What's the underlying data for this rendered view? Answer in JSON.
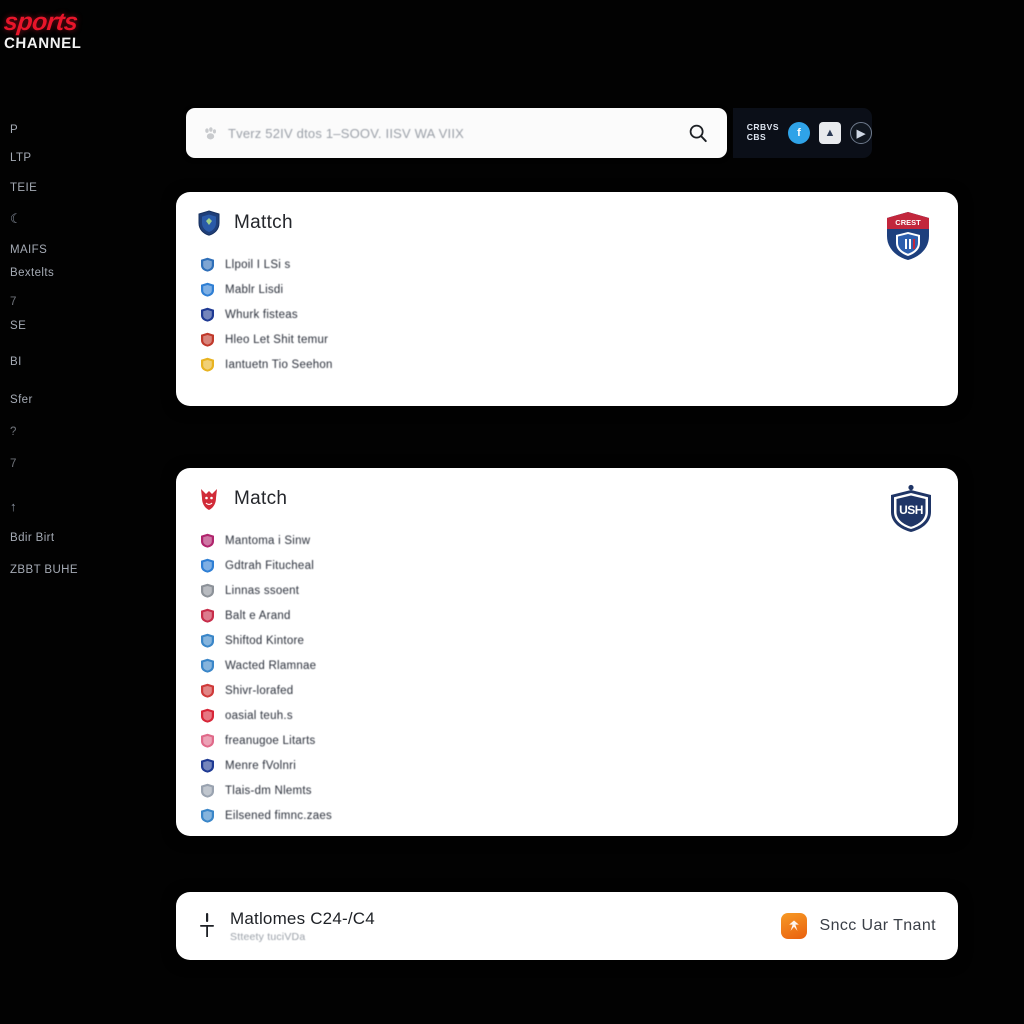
{
  "brand": {
    "line1": "sports",
    "line2": "CHANNEL",
    "accent_color": "#e8152a"
  },
  "sidebar": {
    "items": [
      {
        "label": "P",
        "kind": "text"
      },
      {
        "label": "LTP",
        "kind": "text"
      },
      {
        "label": "TEIE",
        "kind": "text"
      },
      {
        "label": "☾",
        "kind": "icon"
      },
      {
        "label": "MAIFS",
        "kind": "text"
      },
      {
        "label": "Bextelts",
        "kind": "text"
      },
      {
        "label": "7",
        "kind": "dim"
      },
      {
        "label": "SE",
        "kind": "text"
      },
      {
        "label": "BI",
        "kind": "text"
      },
      {
        "label": "Sfer",
        "kind": "text"
      },
      {
        "label": "?",
        "kind": "dim"
      },
      {
        "label": "7",
        "kind": "dim"
      },
      {
        "label": "↑",
        "kind": "icon"
      },
      {
        "label": "Bdir Birt",
        "kind": "text"
      },
      {
        "label": "ZBBT BUHE",
        "kind": "text"
      }
    ]
  },
  "search": {
    "value": "",
    "placeholder": "Tverz 52IV dtos 1–SOOV. IISV WA VIIX",
    "lead_icon": "paw-icon",
    "submit_icon": "search-icon"
  },
  "social": {
    "label": "CRBVS\nCBS",
    "icons": [
      {
        "name": "facebook-icon",
        "glyph": "f",
        "style": "blue"
      },
      {
        "name": "share-icon",
        "glyph": "▲",
        "style": "white"
      },
      {
        "name": "player-icon",
        "glyph": "▶",
        "style": "dark"
      }
    ]
  },
  "cards": [
    {
      "id": "card-1",
      "title": "Mattch",
      "crest_icon": "blue-shield-crest-icon",
      "logo_icon": "red-blue-team-crest-logo",
      "items": [
        {
          "text": "Llpoil I LSi s",
          "icon": "blue-shield-icon",
          "color": "#2f6fb8"
        },
        {
          "text": "Mablr Lisdi",
          "icon": "blue-square-icon",
          "color": "#2f7fd4"
        },
        {
          "text": "Whurk fisteas",
          "icon": "navy-crest-icon",
          "color": "#1f3a93"
        },
        {
          "text": "Hleo Let Shit temur",
          "icon": "red-crest-icon",
          "color": "#c0392b"
        },
        {
          "text": "Iantuetn Tio Seehon",
          "icon": "yellow-badge-icon",
          "color": "#e8b321"
        }
      ]
    },
    {
      "id": "card-2",
      "title": "Match",
      "crest_icon": "red-bull-crest-icon",
      "logo_icon": "navy-usa-shield-logo",
      "items": [
        {
          "text": "Mantoma i  Sinw",
          "icon": "magenta-ball-icon",
          "color": "#b0256d"
        },
        {
          "text": "Gdtrah Fitucheal",
          "icon": "blue-flag-icon",
          "color": "#2f7fd4"
        },
        {
          "text": "Linnas ssoent",
          "icon": "gray-dash-icon",
          "color": "#8d9299"
        },
        {
          "text": "Balt e Arand",
          "icon": "red-badge-icon",
          "color": "#c72d4a"
        },
        {
          "text": "Shiftod Kintore",
          "icon": "blue-small-icon",
          "color": "#3a86c8"
        },
        {
          "text": "Wacted Rlamnae",
          "icon": "blue-u-icon",
          "color": "#3a86c8"
        },
        {
          "text": "Shivr-lorafed",
          "icon": "red-outline-icon",
          "color": "#cf3a3a"
        },
        {
          "text": "oasial teuh.s",
          "icon": "red-heart-icon",
          "color": "#d72638"
        },
        {
          "text": "freanugoe Litarts",
          "icon": "pink-oval-icon",
          "color": "#e06a8a"
        },
        {
          "text": "Menre fVolnri",
          "icon": "navy-grid-icon",
          "color": "#1f3a93"
        },
        {
          "text": "Tlais-dm Nlemts",
          "icon": "gray-globe-icon",
          "color": "#9aa3b0"
        },
        {
          "text": "Eilsened fimnc.zaes",
          "icon": "blue-card-icon",
          "color": "#3a86c8"
        }
      ]
    }
  ],
  "bottom_bar": {
    "pin_icon": "pin-marker-icon",
    "title": "Matlomes C24-/C4",
    "subtitle": "Stteety tuciVDa",
    "badge_icon": "orange-app-icon",
    "right_text": "Sncc Uar Tnant"
  }
}
